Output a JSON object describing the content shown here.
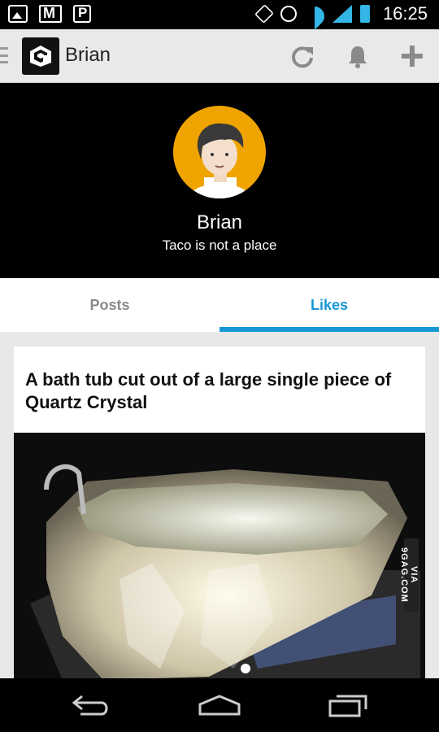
{
  "status_bar": {
    "time": "16:25",
    "icons": [
      "gallery-icon",
      "gmail-icon",
      "pocket-icon",
      "rotation-lock-icon",
      "alarm-icon",
      "wifi-icon",
      "signal-icon",
      "battery-icon"
    ]
  },
  "app_bar": {
    "title": "Brian",
    "logo": "9gag-logo",
    "actions": [
      "refresh-icon",
      "bell-icon",
      "plus-icon"
    ]
  },
  "profile": {
    "name": "Brian",
    "bio": "Taco is not a place",
    "avatar_color": "#f0a400"
  },
  "tabs": [
    {
      "label": "Posts",
      "active": false
    },
    {
      "label": "Likes",
      "active": true
    }
  ],
  "accent_color": "#1997d4",
  "post": {
    "title": "A bath tub cut out of a large single piece of Quartz Crystal",
    "watermark": "VIA 9GAG.COM"
  },
  "nav_bar": {
    "buttons": [
      "back-icon",
      "home-icon",
      "recent-apps-icon"
    ]
  }
}
